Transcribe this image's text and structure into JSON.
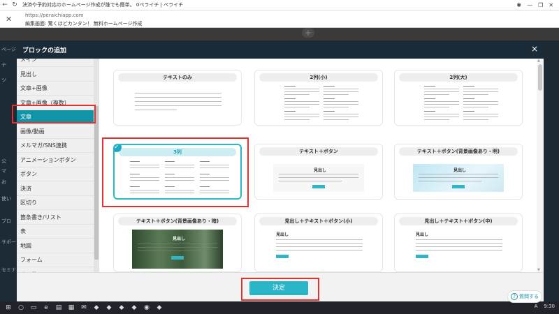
{
  "browser": {
    "tab_title": "決済や予約対応のホームページ作成が誰でも簡単。 0ペライチ | ペライチ",
    "url": "https://peraichiapp.com",
    "page_subtitle": "編集画面: 驚くほどカンタン！ 無料ホームページ作成"
  },
  "background_sidebar": [
    "ページ",
    "テ",
    "ツ",
    "公",
    "マ",
    "お",
    "使い",
    "ブロ",
    "サポー",
    "セミナ"
  ],
  "modal": {
    "title": "ブロックの追加",
    "close": "×",
    "decide_button": "決定"
  },
  "categories": [
    {
      "label": "メイン",
      "active": false
    },
    {
      "label": "見出し",
      "active": false
    },
    {
      "label": "文章+画像",
      "active": false
    },
    {
      "label": "文章+画像（複数）",
      "active": false
    },
    {
      "label": "文章",
      "active": true
    },
    {
      "label": "画像/動画",
      "active": false
    },
    {
      "label": "メルマガ/SNS連携",
      "active": false
    },
    {
      "label": "アニメーションボタン",
      "active": false
    },
    {
      "label": "ボタン",
      "active": false
    },
    {
      "label": "決済",
      "active": false
    },
    {
      "label": "区切り",
      "active": false
    },
    {
      "label": "箇条書き/リスト",
      "active": false
    },
    {
      "label": "表",
      "active": false
    },
    {
      "label": "地図",
      "active": false
    },
    {
      "label": "フォーム",
      "active": false
    },
    {
      "label": "その他",
      "active": false
    }
  ],
  "blocks": [
    {
      "title": "テキストのみ",
      "selected": false,
      "thumb": "text-only"
    },
    {
      "title": "2列(小)",
      "selected": false,
      "thumb": "two-col"
    },
    {
      "title": "2列(大)",
      "selected": false,
      "thumb": "two-col"
    },
    {
      "title": "3列",
      "selected": true,
      "thumb": "three-col"
    },
    {
      "title": "テキスト＋ボタン",
      "selected": false,
      "thumb": "text-button",
      "thumb_heading": "見出し",
      "thumb_button": "ボタン"
    },
    {
      "title": "テキスト＋ボタン(背景画像あり・明)",
      "selected": false,
      "thumb": "bg-light",
      "thumb_heading": "見出し",
      "thumb_button": "ボタン"
    },
    {
      "title": "テキスト＋ボタン(背景画像あり・暗)",
      "selected": false,
      "thumb": "bg-dark",
      "thumb_heading": "見出し",
      "thumb_button": "ボタン"
    },
    {
      "title": "見出し＋テキスト＋ボタン(小)",
      "selected": false,
      "thumb": "head-text-button",
      "thumb_heading": "見出し",
      "thumb_button": "ボタン"
    },
    {
      "title": "見出し＋テキスト＋ボタン(中)",
      "selected": false,
      "thumb": "head-text-button",
      "thumb_heading": "見出し",
      "thumb_button": "ボタン"
    }
  ],
  "help_button": "質問する",
  "taskbar": {
    "clock": "9:30",
    "ime": "A"
  },
  "colors": {
    "accent": "#2ab6c6",
    "active_category": "#1094a8",
    "highlight": "#e53030",
    "modal_header": "#1a2a36"
  }
}
